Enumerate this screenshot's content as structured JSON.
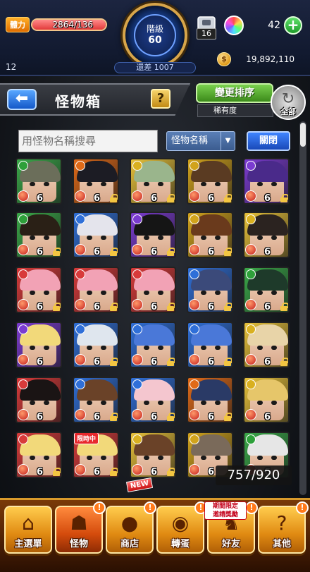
{
  "status": {
    "stamina_label": "體力",
    "stamina_text": "2864/136",
    "stamina_ratio": 1.0,
    "rank_label": "階級",
    "rank_value": "60",
    "rank_remaining": "還差 1007",
    "box_count": "16",
    "orb_count": "42",
    "level_small": "12",
    "gold": "19,892,110"
  },
  "header": {
    "title": "怪物箱",
    "help_label": "?",
    "sort_label": "變更排序",
    "sort_sub": "稀有度",
    "all_label": "全部"
  },
  "search": {
    "placeholder": "用怪物名稱搜尋",
    "select_value": "怪物名稱",
    "close_label": "關閉"
  },
  "grid": {
    "counter": "757/920",
    "cards": [
      {
        "bg": "#3aa849",
        "hair": "#6b6e5a",
        "el": "#2ea03a",
        "lvl": "6",
        "lock": false
      },
      {
        "bg": "#e06a18",
        "hair": "#1c1c24",
        "el": "#e06a18",
        "lvl": "6",
        "lock": true
      },
      {
        "bg": "#e8c23a",
        "hair": "#9ab58c",
        "el": "#d9b020",
        "lvl": "6",
        "lock": true
      },
      {
        "bg": "#d1a31c",
        "hair": "#5a3b22",
        "el": "#d1a31c",
        "lvl": "6",
        "lock": true
      },
      {
        "bg": "#7b3bd1",
        "hair": "#4a2a8a",
        "el": "#7b3bd1",
        "lvl": "6",
        "lock": true
      },
      {
        "bg": "#3aa849",
        "hair": "#2a2016",
        "el": "#2ea03a",
        "lvl": "6",
        "lock": true
      },
      {
        "bg": "#2f6fd8",
        "hair": "#e4e4ec",
        "el": "#2f6fd8",
        "lvl": "6",
        "lock": true
      },
      {
        "bg": "#7b3bd1",
        "hair": "#151515",
        "el": "#7b3bd1",
        "lvl": "6",
        "lock": true
      },
      {
        "bg": "#d1a31c",
        "hair": "#6a3a1c",
        "el": "#d1a31c",
        "lvl": "6",
        "lock": true
      },
      {
        "bg": "#e8c23a",
        "hair": "#2b2320",
        "el": "#d9b020",
        "lvl": "6",
        "lock": false
      },
      {
        "bg": "#d83a3a",
        "hair": "#f2a2b5",
        "el": "#d83a3a",
        "lvl": "6",
        "lock": true
      },
      {
        "bg": "#d83a3a",
        "hair": "#f2a2b5",
        "el": "#d83a3a",
        "lvl": "6",
        "lock": true
      },
      {
        "bg": "#d83a3a",
        "hair": "#f2a2b5",
        "el": "#d83a3a",
        "lvl": "6",
        "lock": true
      },
      {
        "bg": "#2f6fd8",
        "hair": "#3b4a7a",
        "el": "#2f6fd8",
        "lvl": "6",
        "lock": true
      },
      {
        "bg": "#3aa849",
        "hair": "#1e3a2a",
        "el": "#2ea03a",
        "lvl": "6",
        "lock": true
      },
      {
        "bg": "#7b3bd1",
        "hair": "#f2d97a",
        "el": "#7b3bd1",
        "lvl": "6",
        "lock": false
      },
      {
        "bg": "#2f6fd8",
        "hair": "#dfe6ee",
        "el": "#2f6fd8",
        "lvl": "6",
        "lock": true
      },
      {
        "bg": "#2f6fd8",
        "hair": "#4a78d8",
        "el": "#2f6fd8",
        "lvl": "6",
        "lock": true
      },
      {
        "bg": "#2f6fd8",
        "hair": "#4a78d8",
        "el": "#2f6fd8",
        "lvl": "6",
        "lock": true
      },
      {
        "bg": "#e8c23a",
        "hair": "#e8d4a8",
        "el": "#d9b020",
        "lvl": "6",
        "lock": true
      },
      {
        "bg": "#d83a3a",
        "hair": "#1a1414",
        "el": "#d83a3a",
        "lvl": "6",
        "lock": false
      },
      {
        "bg": "#2f6fd8",
        "hair": "#6a4228",
        "el": "#2f6fd8",
        "lvl": "6",
        "lock": true
      },
      {
        "bg": "#2f6fd8",
        "hair": "#f4c6cf",
        "el": "#2f6fd8",
        "lvl": "6",
        "lock": true
      },
      {
        "bg": "#e06a18",
        "hair": "#2a3a66",
        "el": "#e06a18",
        "lvl": "6",
        "lock": true
      },
      {
        "bg": "#e8c23a",
        "hair": "#e6c66a",
        "el": "#d9b020",
        "lvl": "6",
        "lock": false
      },
      {
        "bg": "#d83a3a",
        "hair": "#f2d97a",
        "el": "#d83a3a",
        "lvl": "6",
        "lock": true
      },
      {
        "bg": "#d83a3a",
        "hair": "#f2d97a",
        "el": "#d83a3a",
        "lvl": "6",
        "lock": true
      },
      {
        "bg": "#e8c23a",
        "hair": "#6a4228",
        "el": "#d9b020",
        "lvl": "6",
        "lock": true
      },
      {
        "bg": "#d1a31c",
        "hair": "#7a6a5a",
        "el": "#d1a31c",
        "lvl": "6",
        "lock": false
      },
      {
        "bg": "#3aa849",
        "hair": "#e6e6e6",
        "el": "#2ea03a",
        "lvl": "6",
        "lock": false
      }
    ],
    "limited_label": "限時中",
    "new_label": "NEW"
  },
  "nav": {
    "items": [
      {
        "label": "主選單",
        "glyph": "⌂",
        "active": false,
        "notice": false
      },
      {
        "label": "怪物",
        "glyph": "☗",
        "active": true,
        "notice": true
      },
      {
        "label": "商店",
        "glyph": "●",
        "active": false,
        "notice": true
      },
      {
        "label": "轉蛋",
        "glyph": "◉",
        "active": false,
        "notice": true
      },
      {
        "label": "好友",
        "glyph": "♞",
        "active": false,
        "notice": true
      },
      {
        "label": "其他",
        "glyph": "?",
        "active": false,
        "notice": true
      }
    ],
    "event_tag": "期間限定\n邀請獎勵",
    "notice_glyph": "!"
  },
  "colors": {
    "accent": "#d99a2b",
    "nav_bg": "#4a1e04",
    "sort_green": "#3b8a1a",
    "close_blue": "#1a49b8"
  }
}
